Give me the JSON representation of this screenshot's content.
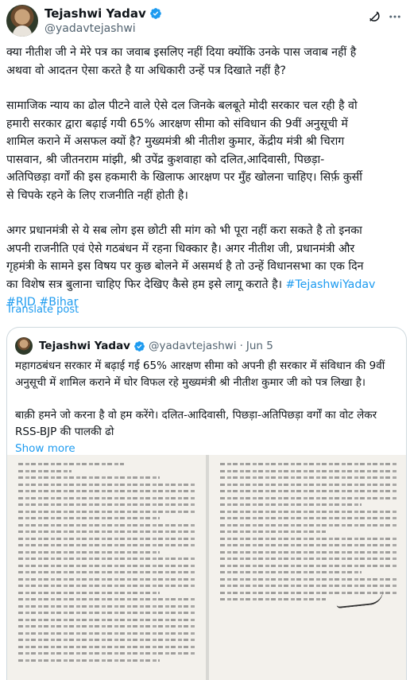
{
  "author": {
    "name": "Tejashwi Yadav",
    "handle": "@yadavtejashwi"
  },
  "icons": {
    "verified": "verified-badge-icon",
    "grok": "grok-icon",
    "more": "more-options-icon"
  },
  "colors": {
    "link": "#1d9bf0",
    "text": "#0f1419",
    "muted": "#536471",
    "verified": "#1d9bf0"
  },
  "tweet": {
    "para1_line1": "क्या नीतीश जी ने मेरे पत्र का जवाब इसलिए नहीं दिया क्योंकि उनके पास जवाब नहीं है",
    "para1_line2": "अथवा वो आदतन ऐसा करते है या अधिकारी उन्हें पत्र दिखाते नहीं है?",
    "para2_line1": "सामाजिक न्याय का ढोल पीटने वाले ऐसे दल जिनके बलबूते मोदी सरकार चल रही है वो",
    "para2_line2": "हमारी सरकार द्वारा बढ़ाई गयी 65% आरक्षण सीमा को संविधान की 9वीं अनुसूची में",
    "para2_line3": "शामिल कराने में असफल क्यों है? मुख्यमंत्री श्री नीतीश कुमार, केंद्रीय मंत्री श्री चिराग",
    "para2_line4": "पासवान, श्री जीतनराम मांझी, श्री उपेंद्र कुशवाहा को दलित,आदिवासी, पिछड़ा-",
    "para2_line5": "अतिपिछड़ा वर्गों की इस हकमारी के खिलाफ आरक्षण पर मुँह खोलना चाहिए। सिर्फ़ कुर्सी",
    "para2_line6": "से चिपके रहने के लिए राजनीति नहीं होती है।",
    "para3_line1": "अगर प्रधानमंत्री से ये सब लोग इस छोटी सी मांग को भी पूरा नहीं करा सकते है तो इनका",
    "para3_line2": "अपनी राजनीति एवं ऐसे गठबंधन में रहना धिक्कार है। अगर नीतीश जी, प्रधानमंत्री और",
    "para3_line3": "गृहमंत्री के सामने इस विषय पर कुछ बोलने में असमर्थ है तो उन्हें विधानसभा का एक दिन",
    "para3_line4": "का विशेष सत्र बुलाना चाहिए फिर देखिए कैसे हम इसे लागू कराते है।",
    "hashtag1": "#TejashwiYadav",
    "hashtag2": "#RJD",
    "hashtag3": "#Bihar",
    "translate": "Translate post"
  },
  "quote": {
    "name": "Tejashwi Yadav",
    "handle": "@yadavtejashwi",
    "separator": "·",
    "date": "Jun 5",
    "line1": "महागठबंधन सरकार में बढ़ाई गई 65% आरक्षण सीमा को अपनी ही सरकार में संविधान की 9वीं",
    "line2": "अनुसूची में शामिल कराने में घोर विफल रहे मुख्यमंत्री श्री नीतीश कुमार जी को पत्र लिखा है।",
    "line3": "बाक़ी हमने जो करना है वो हम करेंगे। दलित-आदिवासी, पिछड़ा-अतिपिछड़ा वर्गों का वोट लेकर",
    "line4": "RSS-BJP की पालकी ढो",
    "show_more": "Show more",
    "image_alt": "letter-image"
  }
}
